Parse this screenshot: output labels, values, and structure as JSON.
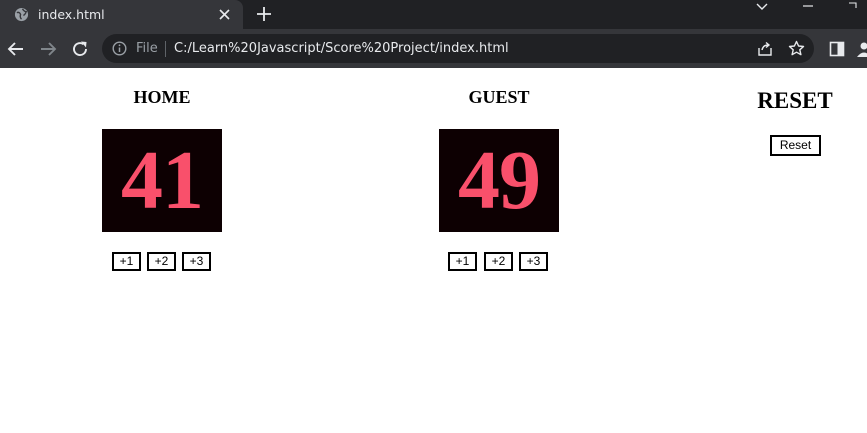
{
  "browser": {
    "tab_title": "index.html",
    "scheme_label": "File",
    "url": "C:/Learn%20Javascript/Score%20Project/index.html",
    "colors": {
      "tabbar": "#202124",
      "toolbar": "#35363a",
      "omnibox": "#202124"
    }
  },
  "home": {
    "title": "HOME",
    "score": "41",
    "buttons": [
      "+1",
      "+2",
      "+3"
    ]
  },
  "guest": {
    "title": "GUEST",
    "score": "49",
    "buttons": [
      "+1",
      "+2",
      "+3"
    ]
  },
  "reset": {
    "title": "RESET",
    "button_label": "Reset"
  },
  "colors": {
    "score_background": "#0d0002",
    "score_text": "#f9506b"
  }
}
